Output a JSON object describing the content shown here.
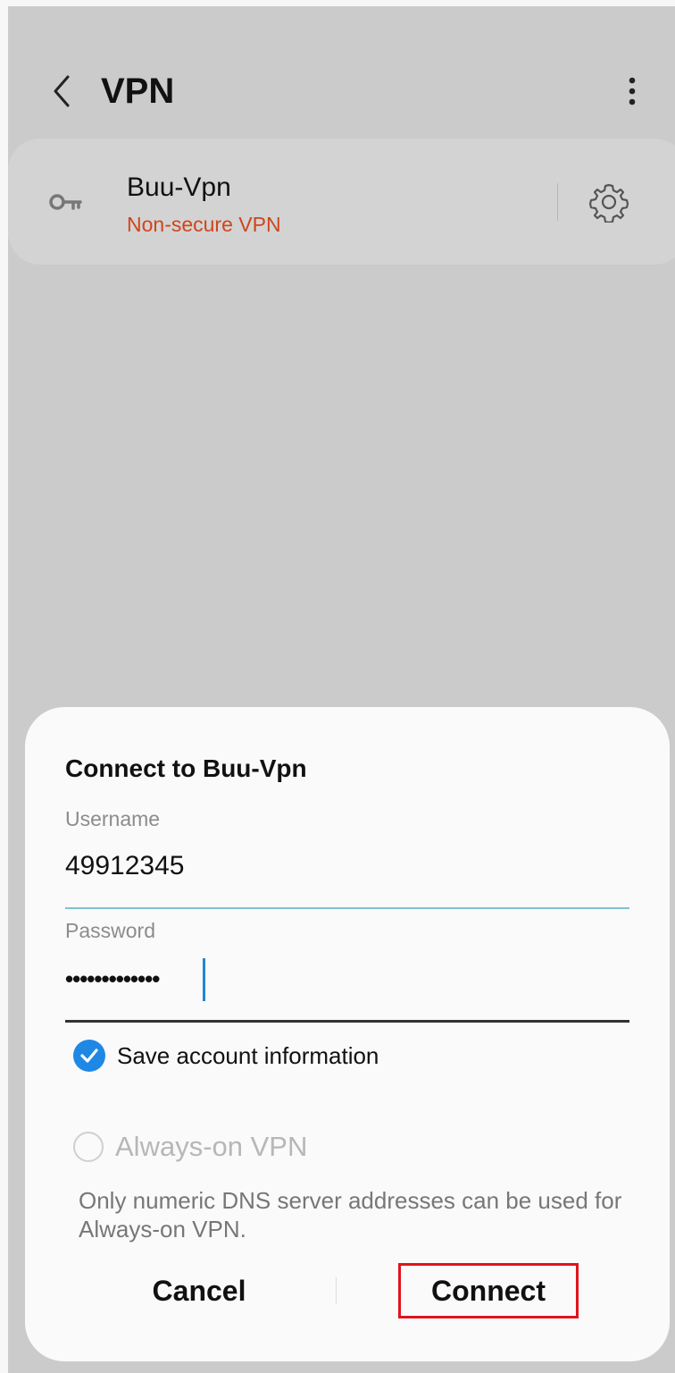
{
  "header": {
    "title": "VPN"
  },
  "vpn_item": {
    "name": "Buu-Vpn",
    "status": "Non-secure VPN",
    "status_color": "#d0451b"
  },
  "dialog": {
    "title": "Connect to Buu-Vpn",
    "username_label": "Username",
    "username_value": "49912345",
    "password_label": "Password",
    "password_value": "•••••••••••••",
    "save_account_label": "Save account information",
    "save_account_checked": true,
    "always_on_label": "Always-on VPN",
    "always_on_checked": false,
    "note": "Only numeric DNS server addresses can be used for Always-on VPN.",
    "cancel_label": "Cancel",
    "connect_label": "Connect",
    "accent_color": "#1f88e5"
  },
  "icons": {
    "back": "chevron-left-icon",
    "more": "more-vert-icon",
    "key": "key-icon",
    "settings": "gear-icon",
    "check": "check-icon"
  }
}
